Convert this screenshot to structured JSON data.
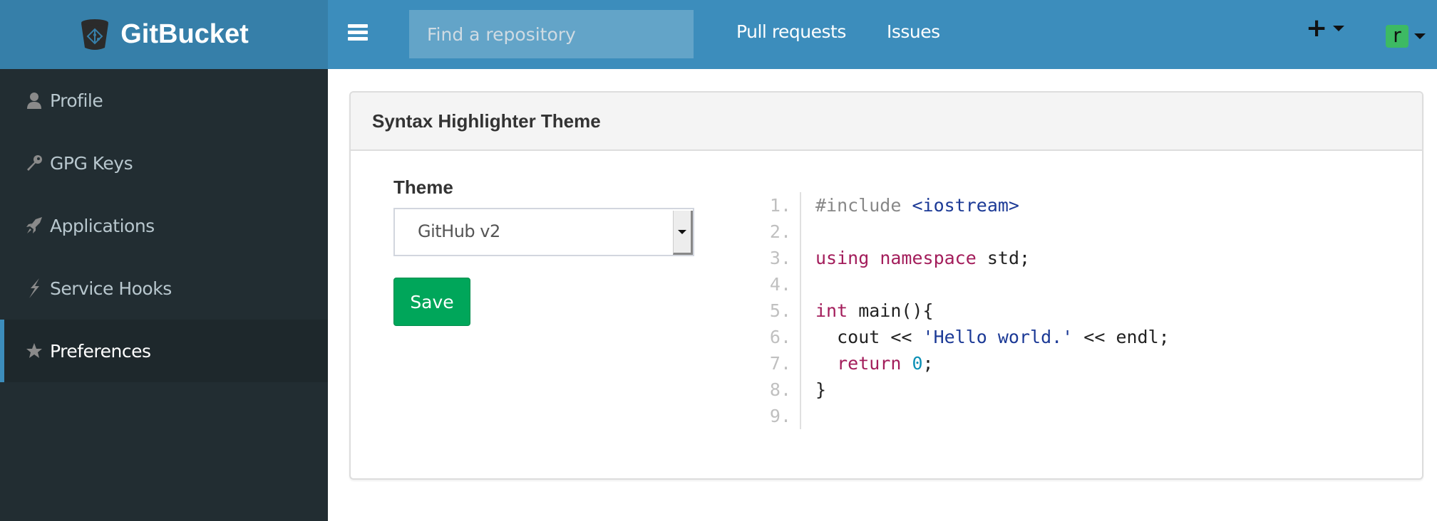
{
  "app": {
    "name": "GitBucket",
    "logo_icon": "bucket-logo-icon"
  },
  "navbar": {
    "menu_icon": "hamburger-menu-icon",
    "search_placeholder": "Find a repository",
    "search_value": "",
    "links": [
      {
        "label": "Pull requests"
      },
      {
        "label": "Issues"
      }
    ],
    "create_label": "+",
    "user_initial": "r",
    "colors": {
      "navbar": "#3c8dbc",
      "brand": "#367fa9",
      "avatar": "#3dba63"
    }
  },
  "sidebar": {
    "items": [
      {
        "label": "Profile",
        "icon": "user-icon",
        "active": false
      },
      {
        "label": "GPG Keys",
        "icon": "key-icon",
        "active": false
      },
      {
        "label": "Applications",
        "icon": "rocket-icon",
        "active": false
      },
      {
        "label": "Service Hooks",
        "icon": "bolt-icon",
        "active": false
      },
      {
        "label": "Preferences",
        "icon": "star-icon",
        "active": true
      }
    ]
  },
  "panel": {
    "title": "Syntax Highlighter Theme",
    "theme_label": "Theme",
    "theme_selected": "GitHub v2",
    "save_label": "Save"
  },
  "code_preview": {
    "lines": [
      {
        "n": "1.",
        "tokens": [
          {
            "t": "#include ",
            "c": "pre"
          },
          {
            "t": "<iostream>",
            "c": "str"
          }
        ]
      },
      {
        "n": "2.",
        "tokens": []
      },
      {
        "n": "3.",
        "tokens": [
          {
            "t": "using",
            "c": "kw"
          },
          {
            "t": " ",
            "c": ""
          },
          {
            "t": "namespace",
            "c": "kw"
          },
          {
            "t": " std;",
            "c": ""
          }
        ]
      },
      {
        "n": "4.",
        "tokens": []
      },
      {
        "n": "5.",
        "tokens": [
          {
            "t": "int",
            "c": "kw"
          },
          {
            "t": " main(){",
            "c": ""
          }
        ]
      },
      {
        "n": "6.",
        "tokens": [
          {
            "t": "  cout << ",
            "c": ""
          },
          {
            "t": "'Hello world.'",
            "c": "str"
          },
          {
            "t": " << endl;",
            "c": ""
          }
        ]
      },
      {
        "n": "7.",
        "tokens": [
          {
            "t": "  ",
            "c": ""
          },
          {
            "t": "return",
            "c": "kw"
          },
          {
            "t": " ",
            "c": ""
          },
          {
            "t": "0",
            "c": "num"
          },
          {
            "t": ";",
            "c": ""
          }
        ]
      },
      {
        "n": "8.",
        "tokens": [
          {
            "t": "}",
            "c": ""
          }
        ]
      },
      {
        "n": "9.",
        "tokens": []
      }
    ]
  }
}
